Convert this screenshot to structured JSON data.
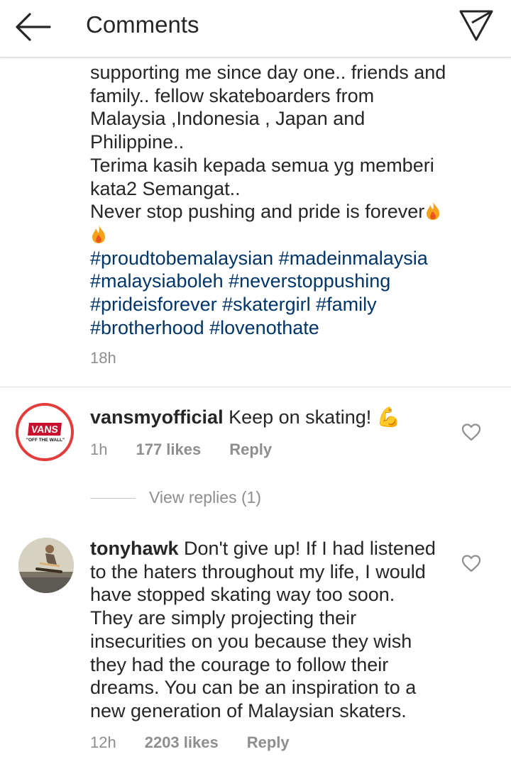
{
  "header": {
    "title": "Comments",
    "back_icon": "arrow-left-icon",
    "send_icon": "paper-plane-icon"
  },
  "caption": {
    "lines": [
      "supporting me since day one.. friends and",
      "family.. fellow skateboarders from",
      "Malaysia ,Indonesia , Japan and",
      "Philippine..",
      "Terima kasih kepada semua yg memberi",
      "kata2 Semangat.."
    ],
    "last_line": "Never stop pushing and pride is forever",
    "hashtag_lines": [
      "#proudtobemalaysian #madeinmalaysia",
      "#malaysiaboleh #neverstoppushing",
      "#prideisforever #skatergirl #family",
      "#brotherhood #lovenothate"
    ],
    "time": "18h"
  },
  "comments": [
    {
      "username": "vansmyofficial",
      "text": "Keep on skating!",
      "emoji": "💪",
      "time": "1h",
      "likes": "177 likes",
      "reply": "Reply",
      "avatar_logo": "VANS",
      "avatar_tagline": "\"OFF THE WALL\"",
      "view_replies": "View replies (1)"
    },
    {
      "username": "tonyhawk",
      "first_line": "Don't give up! If I had listened",
      "lines": [
        "to the haters throughout my life, I would",
        "have stopped skating way too soon.",
        "They are simply projecting their",
        "insecurities on you because they wish",
        "they had the courage to follow their",
        "dreams. You can be an inspiration to a",
        "new generation of Malaysian skaters."
      ],
      "time": "12h",
      "likes": "2203 likes",
      "reply": "Reply"
    }
  ],
  "colors": {
    "hashtag": "#003569",
    "flame": "#f4a31b",
    "muted": "#8e8e8e"
  }
}
